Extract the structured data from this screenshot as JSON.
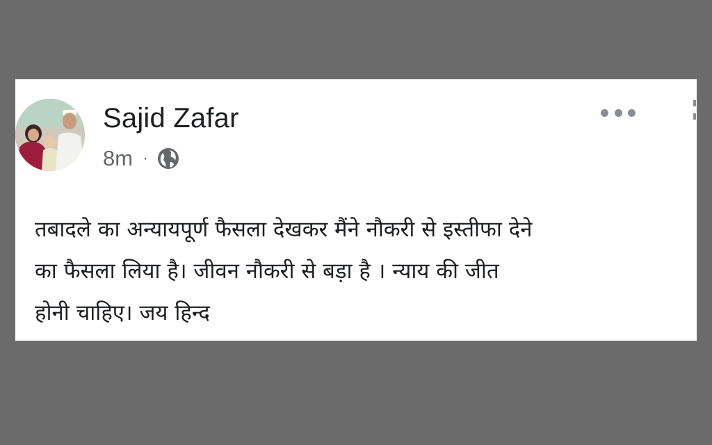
{
  "post": {
    "author_name": "Sajid Zafar",
    "timestamp": "8m",
    "separator": "·",
    "audience_icon": "globe-icon",
    "more_icon": "more-horizontal-icon",
    "lines": [
      "तबादले का अन्यायपूर्ण फैसला देखकर मैंने नौकरी से इस्तीफा देने",
      "का फैसला लिया है। जीवन नौकरी से बड़ा है । न्याय की जीत",
      "होनी चाहिए। जय हिन्द"
    ]
  },
  "colors": {
    "background": "#6b6b6b",
    "card": "#ffffff",
    "primary_text": "#1c1e21",
    "secondary_text": "#65676b",
    "icon": "#8a8d91"
  }
}
